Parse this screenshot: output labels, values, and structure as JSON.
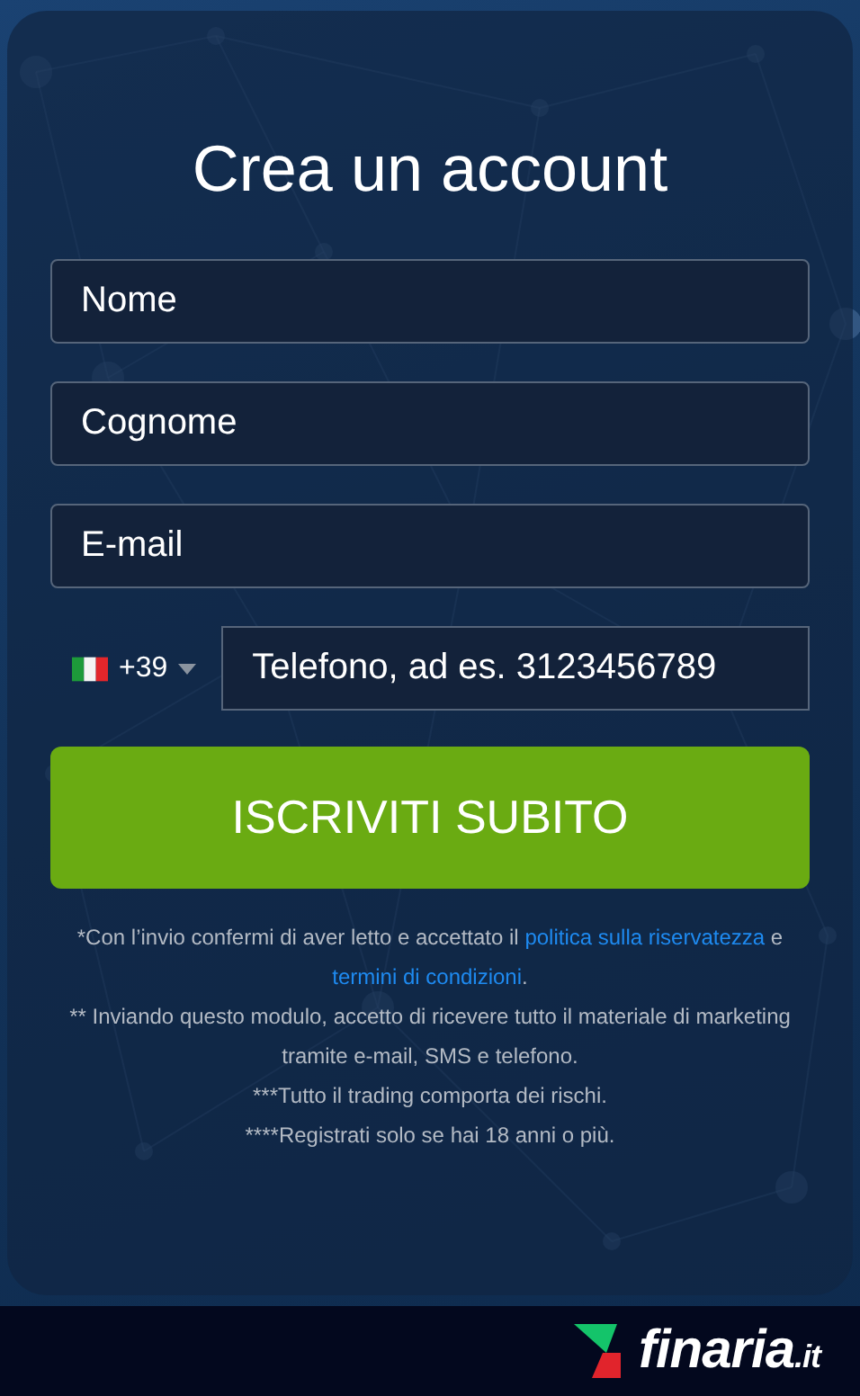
{
  "title": "Crea un account",
  "fields": [
    {
      "placeholder": "Nome"
    },
    {
      "placeholder": "Cognome"
    },
    {
      "placeholder": "E-mail"
    }
  ],
  "phone": {
    "country_code": "+39",
    "placeholder": "Telefono, ad es. 3123456789"
  },
  "submit_button": "ISCRIVITI SUBITO",
  "consent": {
    "text_1": "*Con l’invio confermi di aver letto e accettato il",
    "link_1": "politica sulla riservatezza",
    "text_2": "e",
    "link_2": "termini di condizioni",
    "text_3": "."
  },
  "notes": [
    "** Inviando questo modulo, accetto di ricevere tutto il materiale di marketing tramite e-mail, SMS e telefono.",
    "***Tutto il trading comporta dei rischi.",
    "****Registrati solo se hai 18 anni o più."
  ],
  "footer": {
    "logo_name": "finaria",
    "logo_suffix": ".it"
  }
}
